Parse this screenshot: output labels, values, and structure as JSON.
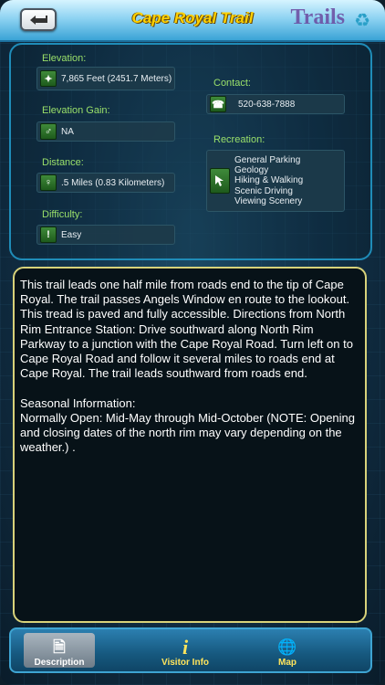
{
  "header": {
    "title": "Cape Royal Trail",
    "brand": "Trails",
    "recycle_icon": "recycle-icon",
    "back_icon": "back-arrow-icon"
  },
  "info": {
    "elevation": {
      "label": "Elevation:",
      "value": "7,865 Feet (2451.7 Meters)",
      "icon": "compass-icon"
    },
    "elevation_gain": {
      "label": "Elevation  Gain:",
      "value": "NA",
      "icon": "gain-icon"
    },
    "distance": {
      "label": "Distance:",
      "value": ".5 Miles (0.83 Kilometers)",
      "icon": "pin-icon"
    },
    "difficulty": {
      "label": "Difficulty:",
      "value": "Easy",
      "icon": "exclamation-icon"
    },
    "contact": {
      "label": "Contact:",
      "value": "520-638-7888",
      "icon": "phone-icon"
    },
    "recreation": {
      "label": "Recreation:",
      "icon": "cursor-icon",
      "items": [
        "General Parking",
        "Geology",
        "Hiking & Walking",
        "Scenic Driving",
        "Viewing Scenery"
      ]
    }
  },
  "description": {
    "text": "This trail leads one half mile from roads end to the tip of Cape Royal. The trail passes Angels Window en route to the lookout. This tread is paved and fully accessible. Directions from North Rim Entrance Station: Drive southward along North Rim Parkway to a junction with the Cape Royal Road. Turn left on to Cape Royal Road and follow it several miles to roads end at Cape Royal. The trail leads southward from roads end.\n\nSeasonal Information:\nNormally Open: Mid-May through Mid-October (NOTE: Opening and closing dates of the north rim may vary depending on the weather.) ."
  },
  "tabs": [
    {
      "label": "Description",
      "icon": "document-icon",
      "active": true
    },
    {
      "label": "Visitor Info",
      "icon": "info-icon",
      "active": false
    },
    {
      "label": "Map",
      "icon": "globe-icon",
      "active": false
    }
  ],
  "colors": {
    "accent_green": "#9ae06a",
    "title_yellow": "#ffd200",
    "panel_border": "#1f8cb8"
  }
}
